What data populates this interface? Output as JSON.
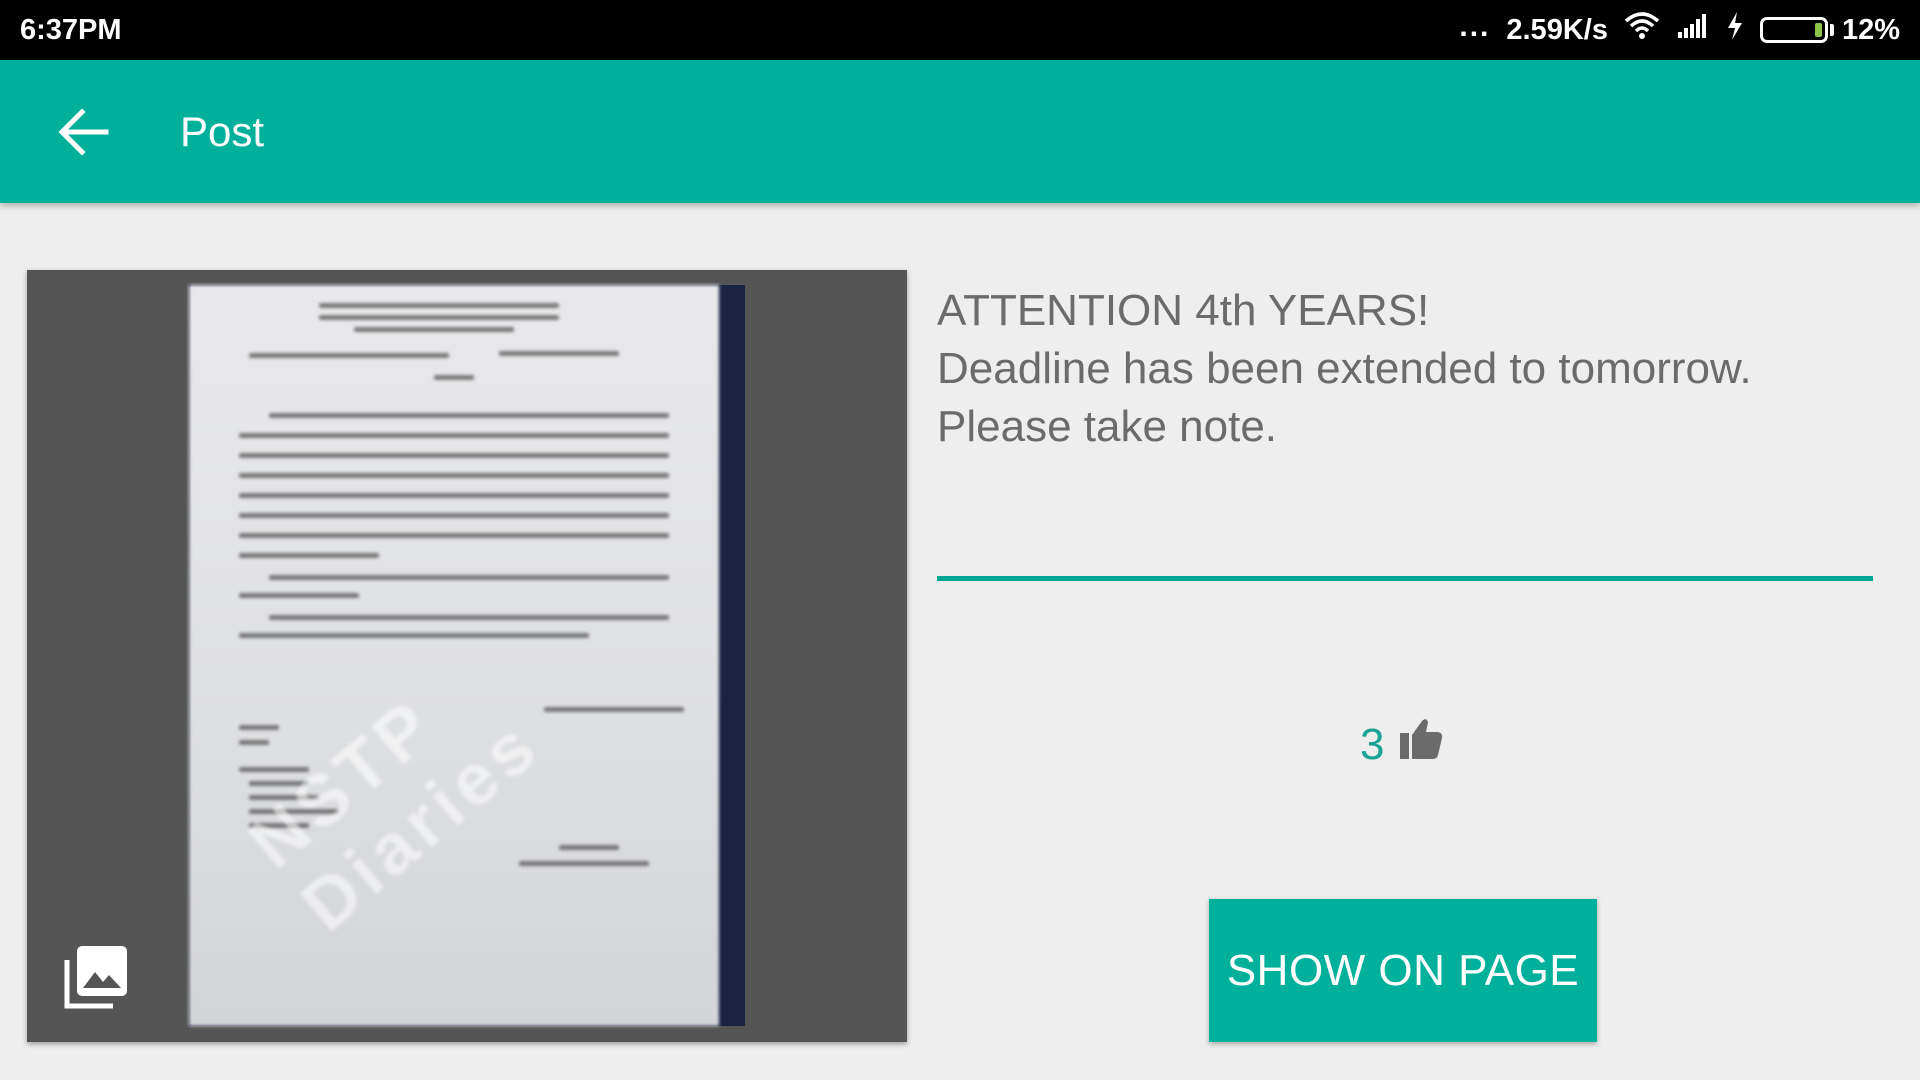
{
  "status_bar": {
    "time": "6:37PM",
    "dots": "...",
    "network_speed": "2.59K/s",
    "battery_percent": "12%",
    "battery_level": 0.12,
    "icons": [
      "wifi-icon",
      "signal-icon",
      "charging-icon",
      "battery-icon"
    ]
  },
  "app_bar": {
    "title": "Post",
    "back_icon": "arrow-left-icon",
    "color": "#00b09b"
  },
  "post": {
    "lines": [
      "ATTENTION 4th YEARS!",
      "Deadline has been extended to tomorrow.",
      "Please take note."
    ],
    "likes": "3",
    "like_icon": "thumbs-up-icon",
    "image_icon": "photo-library-icon",
    "watermark": "NSTP Diaries",
    "button_label": "SHOW ON PAGE"
  },
  "colors": {
    "accent": "#00b09b",
    "text": "#6b6b6b",
    "likes": "#1aa396",
    "background": "#eeeeee"
  }
}
